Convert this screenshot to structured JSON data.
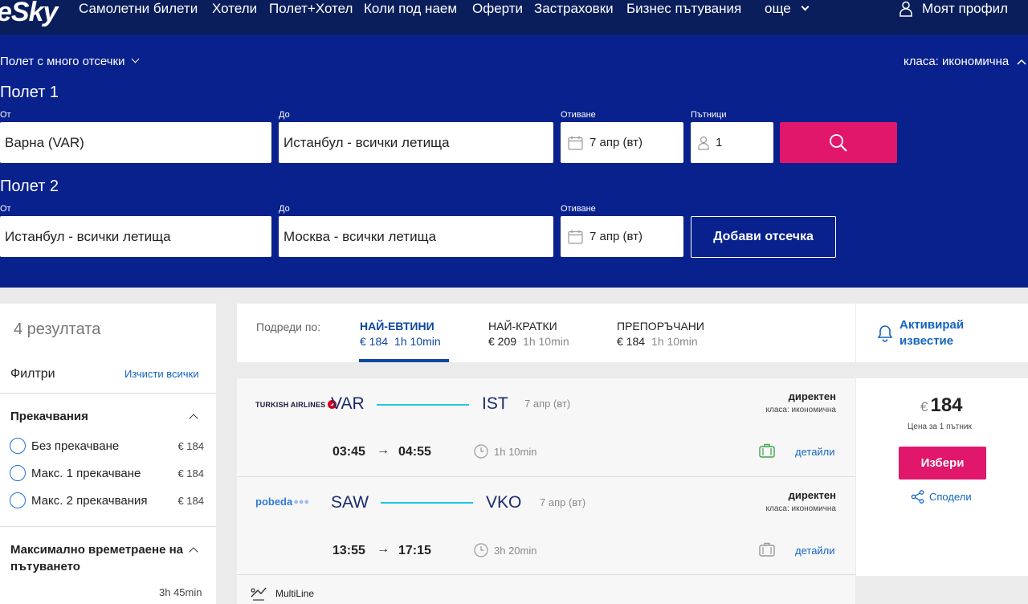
{
  "brand": {
    "logo": "eSky"
  },
  "nav": {
    "items": [
      "Самолетни билети",
      "Хотели",
      "Полет+Хотел",
      "Коли под наем",
      "Оферти",
      "Застраховки",
      "Бизнес пътувания"
    ],
    "more": "още",
    "profile": "Моят профил"
  },
  "search": {
    "mode": "Полет с много отсечки",
    "cabin": "класа: икономична",
    "labels": {
      "from": "От",
      "to": "До",
      "depart": "Отиване",
      "travellers": "Пътници"
    },
    "flights": [
      {
        "title": "Полет 1",
        "from": "Варна (VAR)",
        "to": "Истанбул - всички летища",
        "date": "7 апр (вт)",
        "travellers": "1"
      },
      {
        "title": "Полет 2",
        "from": "Истанбул - всички летища",
        "to": "Москва - всички летища",
        "date": "7 апр (вт)"
      }
    ],
    "add_segment": "Добави отсечка",
    "accent": "#e0176a",
    "panel_color": "#08218c"
  },
  "sidebar": {
    "results_count": "4 резултата",
    "filters_title": "Филтри",
    "clear_all": "Изчисти всички",
    "stops": {
      "title": "Прекачвания",
      "options": [
        {
          "label": "Без прекачване",
          "price": "€ 184"
        },
        {
          "label": "Макс. 1 прекачване",
          "price": "€ 184"
        },
        {
          "label": "Макс. 2 прекачвания",
          "price": "€ 184"
        }
      ]
    },
    "max_duration": {
      "title": "Максимално времетраене на пътуването",
      "value": "3h 45min"
    }
  },
  "sort": {
    "label": "Подреди по:",
    "tabs": [
      {
        "name": "НАЙ-ЕВТИНИ",
        "price": "€ 184",
        "time": "1h 10min",
        "active": true
      },
      {
        "name": "НАЙ-КРАТКИ",
        "price": "€ 209",
        "time": "1h 10min",
        "active": false
      },
      {
        "name": "ПРЕПОРЪЧАНИ",
        "price": "€ 184",
        "time": "1h 10min",
        "active": false
      }
    ],
    "alert": "Активирай известие"
  },
  "result": {
    "segments": [
      {
        "airline": "TURKISH AIRLINES",
        "from": "VAR",
        "to": "IST",
        "date": "7 апр (вт)",
        "direct": "директен",
        "cabin": "класа: икономична",
        "dep": "03:45",
        "arr": "04:55",
        "duration": "1h 10min",
        "details": "детайли"
      },
      {
        "airline": "pobeda",
        "from": "SAW",
        "to": "VKO",
        "date": "7 апр (вт)",
        "direct": "директен",
        "cabin": "класа: икономична",
        "dep": "13:55",
        "arr": "17:15",
        "duration": "3h 20min",
        "details": "детайли"
      }
    ],
    "price_currency": "€",
    "price": "184",
    "price_note": "Цена за 1 пътник",
    "choose": "Избери",
    "share": "Сподели",
    "multiline": "MultiLine"
  }
}
